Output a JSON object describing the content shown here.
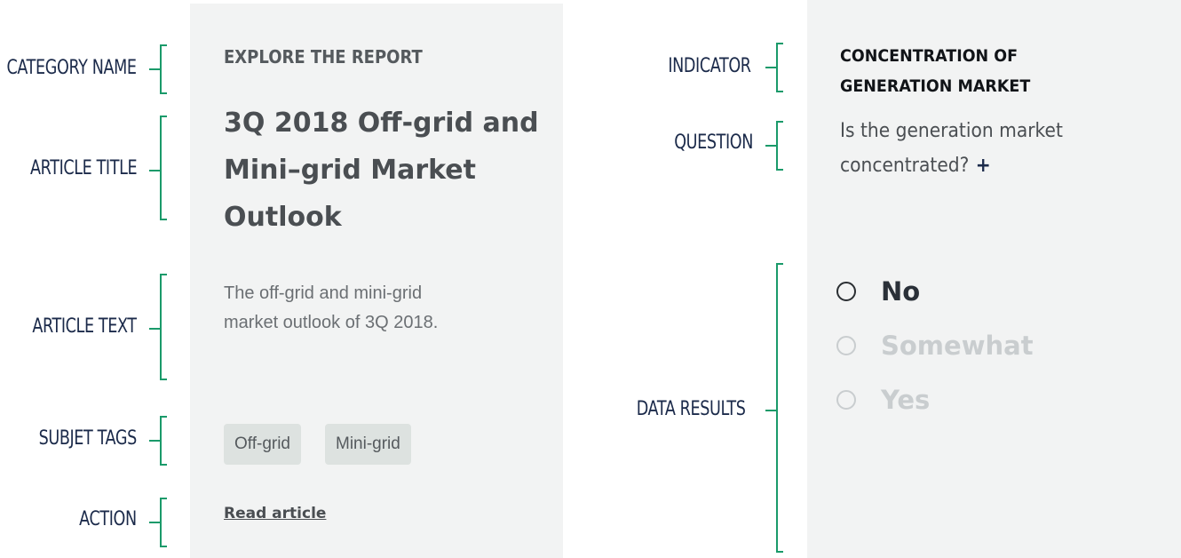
{
  "annotations": {
    "category_name": "CATEGORY NAME",
    "article_title": "ARTICLE TITLE",
    "article_text": "ARTICLE TEXT",
    "subject_tags": "SUBJET TAGS",
    "action": "ACTION",
    "indicator": "INDICATOR",
    "question": "QUESTION",
    "data_results": "DATA RESULTS"
  },
  "article_card": {
    "category": "EXPLORE THE REPORT",
    "title_lines": [
      "3Q 2018 Off-grid and",
      "Mini–grid Market",
      "Outlook"
    ],
    "text_lines": [
      "The off-grid and mini-grid",
      "market outlook of 3Q 2018."
    ],
    "tags": [
      "Off-grid",
      "Mini-grid"
    ],
    "action": "Read article"
  },
  "indicator_card": {
    "indicator_lines": [
      "CONCENTRATION OF",
      "GENERATION MARKET"
    ],
    "question_lines": [
      "Is the generation market",
      "concentrated?"
    ],
    "plus": "+",
    "options": [
      {
        "label": "No",
        "selected": true
      },
      {
        "label": "Somewhat",
        "selected": false
      },
      {
        "label": "Yes",
        "selected": false
      }
    ]
  },
  "colors": {
    "bracket": "#1a9a6a",
    "annotation_text": "#1b2a4a",
    "card_bg": "#f2f3f3",
    "tag_bg": "#dde2e0"
  }
}
